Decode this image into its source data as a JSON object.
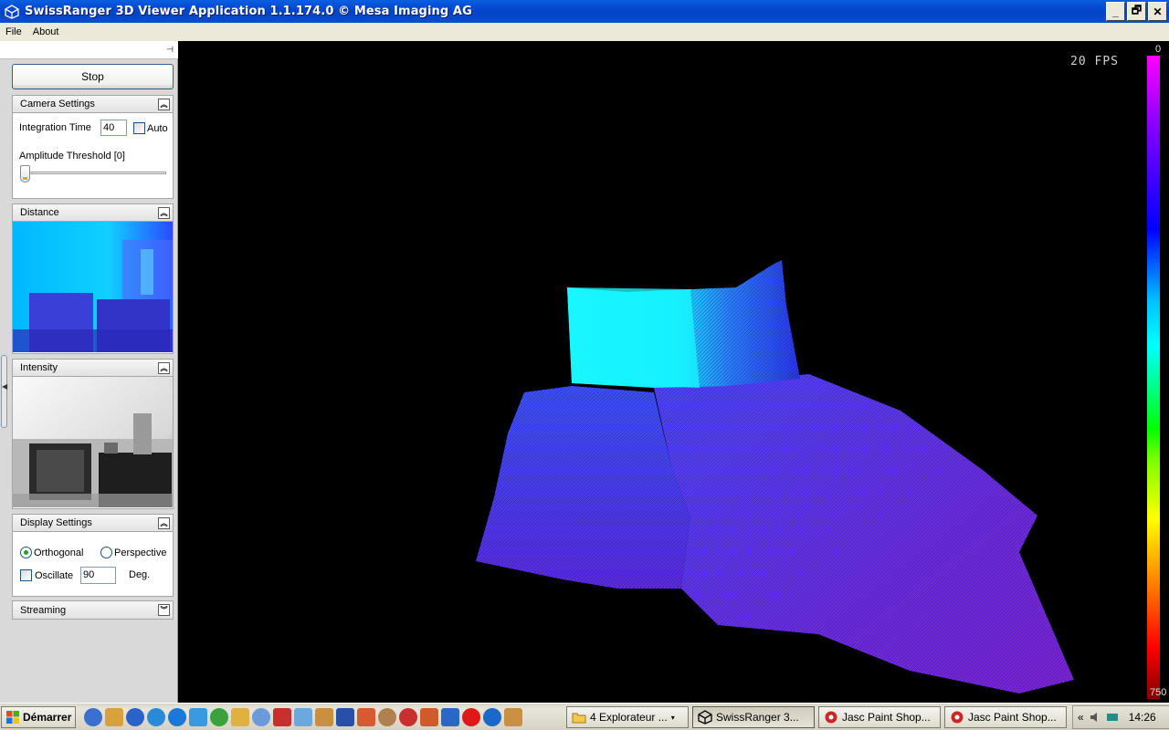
{
  "window": {
    "title": "SwissRanger 3D Viewer Application 1.1.174.0 © Mesa Imaging AG",
    "buttons": {
      "minimize": "_",
      "restore": "🗗",
      "close": "✕"
    }
  },
  "menu": [
    "File",
    "About"
  ],
  "sidebar": {
    "stop_label": "Stop",
    "camera_settings": {
      "title": "Camera Settings",
      "integration_time_label": "Integration Time",
      "integration_time_value": "40",
      "auto_label": "Auto",
      "auto_checked": false,
      "amplitude_threshold_label": "Amplitude Threshold [0]",
      "amplitude_threshold_value": 0
    },
    "distance": {
      "title": "Distance"
    },
    "intensity": {
      "title": "Intensity"
    },
    "display_settings": {
      "title": "Display Settings",
      "orthogonal_label": "Orthogonal",
      "perspective_label": "Perspective",
      "projection_selected": "Orthogonal",
      "oscillate_label": "Oscillate",
      "oscillate_checked": false,
      "oscillate_degrees": "90",
      "degrees_unit": "Deg."
    },
    "streaming": {
      "title": "Streaming"
    }
  },
  "view3d": {
    "fps": "20 FPS",
    "colorscale_min": "0",
    "colorscale_max": "750"
  },
  "taskbar": {
    "start_label": "Démarrer",
    "tasks": [
      {
        "label": "4 Explorateur ...",
        "active": false
      },
      {
        "label": "SwissRanger 3...",
        "active": true
      },
      {
        "label": "Jasc Paint Shop...",
        "active": false
      },
      {
        "label": "Jasc Paint Shop...",
        "active": false
      }
    ],
    "tray_chevron": "«",
    "clock": "14:26"
  },
  "colors": {
    "titlebar": "#0347d0",
    "panel": "#d9d9d9",
    "accent_radio": "#21a121"
  }
}
